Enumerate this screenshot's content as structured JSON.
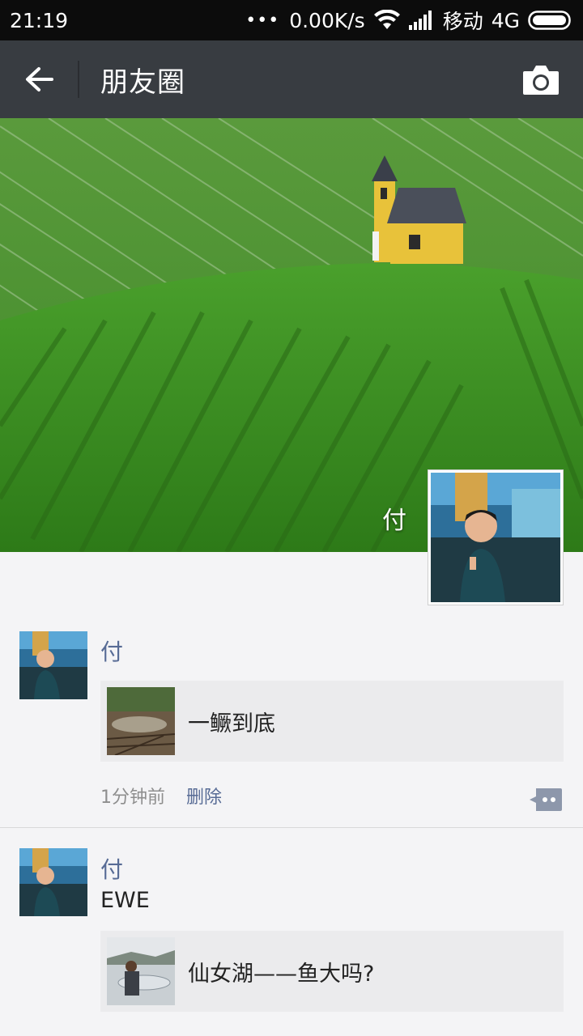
{
  "status_bar": {
    "time": "21:19",
    "network_speed": "0.00K/s",
    "carrier": "移动",
    "network_type": "4G",
    "icons": [
      "wifi-icon",
      "signal-icon",
      "battery-icon"
    ]
  },
  "nav": {
    "back_icon": "back-arrow-icon",
    "title": "朋友圈",
    "camera_icon": "camera-icon"
  },
  "profile": {
    "name": "付"
  },
  "posts": [
    {
      "name": "付",
      "text": "",
      "link_title": "一鳜到底",
      "time": "1分钟前",
      "delete_label": "删除",
      "comment_icon": "comment-icon"
    },
    {
      "name": "付",
      "text": "EWE",
      "link_title": "仙女湖——鱼大吗?"
    }
  ],
  "colors": {
    "nav_bg": "#383c41",
    "status_bg": "#0c0c0c",
    "name_link": "#576b95",
    "card_bg": "#ebebed"
  }
}
